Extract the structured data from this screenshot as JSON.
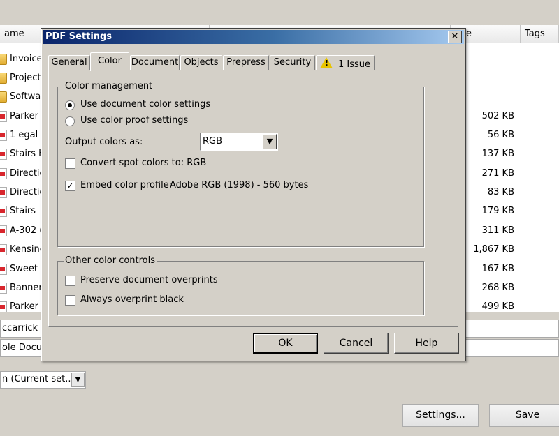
{
  "background": {
    "columns": {
      "name": "ame",
      "size": "e",
      "tags": "Tags"
    },
    "files": [
      {
        "name": "Invoice",
        "type": "folder",
        "size": ""
      },
      {
        "name": "Project",
        "type": "folder",
        "size": ""
      },
      {
        "name": "Softwa",
        "type": "folder",
        "size": ""
      },
      {
        "name": "Parker",
        "type": "pdf",
        "size": "502 KB"
      },
      {
        "name": "1 egal",
        "type": "pdf",
        "size": "56 KB"
      },
      {
        "name": "Stairs K",
        "type": "pdf",
        "size": "137 KB"
      },
      {
        "name": "Directio",
        "type": "pdf",
        "size": "271 KB"
      },
      {
        "name": "Directio",
        "type": "pdf",
        "size": "83 KB"
      },
      {
        "name": "Stairs",
        "type": "pdf",
        "size": "179 KB"
      },
      {
        "name": "A-302 (",
        "type": "pdf",
        "size": "311 KB"
      },
      {
        "name": "Kensing",
        "type": "pdf",
        "size": "1,867 KB"
      },
      {
        "name": "Sweet r",
        "type": "pdf",
        "size": "167 KB"
      },
      {
        "name": "Banner",
        "type": "pdf",
        "size": "268 KB"
      },
      {
        "name": "Parker",
        "type": "pdf",
        "size": "499 KB"
      }
    ],
    "field1": "ccarrick pr",
    "field2": "ole Docum",
    "preset_select": "n (Current set...",
    "settings_button": "Settings...",
    "save_button": "Save"
  },
  "dialog": {
    "title": "PDF Settings",
    "close": "✕",
    "tabs": [
      {
        "label": "General"
      },
      {
        "label": "Color"
      },
      {
        "label": "Document"
      },
      {
        "label": "Objects"
      },
      {
        "label": "Prepress"
      },
      {
        "label": "Security"
      },
      {
        "label": "1 Issue"
      }
    ],
    "active_tab": "Color",
    "color_management": {
      "label": "Color management",
      "radio_document": "Use document color settings",
      "radio_proof": "Use color proof settings",
      "selected": "document",
      "output_label": "Output colors as:",
      "output_value": "RGB",
      "spot_label": "Convert spot colors to: RGB",
      "spot_checked": false,
      "embed_label": "Embed color profile:",
      "embed_value": "Adobe RGB (1998) - 560 bytes",
      "embed_checked": true
    },
    "other_controls": {
      "label": "Other color controls",
      "preserve_label": "Preserve document overprints",
      "preserve_checked": false,
      "overprint_label": "Always overprint black",
      "overprint_checked": false
    },
    "buttons": {
      "ok": "OK",
      "cancel": "Cancel",
      "help": "Help"
    }
  },
  "colors": {
    "title_start": "#0a246a",
    "title_end": "#a6caf0",
    "dialog_face": "#d4d0c8",
    "pdf_red": "#d8262d"
  }
}
